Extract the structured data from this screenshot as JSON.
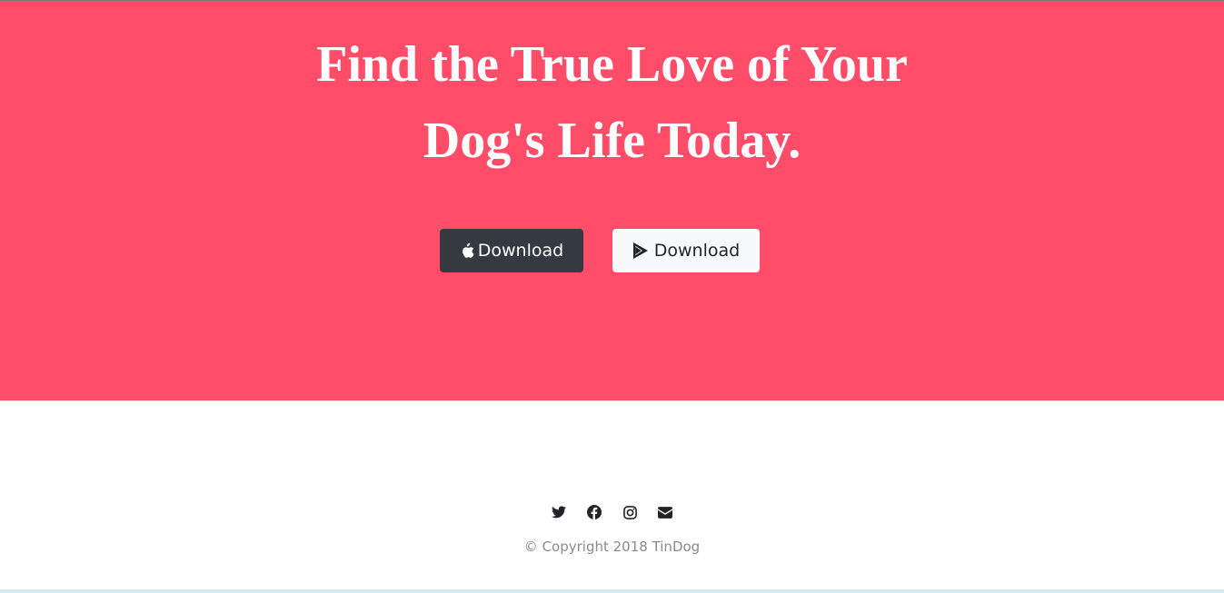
{
  "colors": {
    "hero_background": "#ff4c68",
    "dark_button": "#343a40",
    "light_button": "#f8f9fa",
    "icon_color": "#212529",
    "copyright_text": "#8a8a8a"
  },
  "hero": {
    "title_line_1": "Find the True Love of Your",
    "title_line_2": "Dog's Life Today.",
    "buttons": [
      {
        "label": "Download",
        "icon": "apple-icon"
      },
      {
        "label": "Download",
        "icon": "google-play-icon"
      }
    ]
  },
  "footer": {
    "social_icons": [
      "twitter-icon",
      "facebook-icon",
      "instagram-icon",
      "envelope-icon"
    ],
    "copyright": "© Copyright 2018 TinDog"
  }
}
